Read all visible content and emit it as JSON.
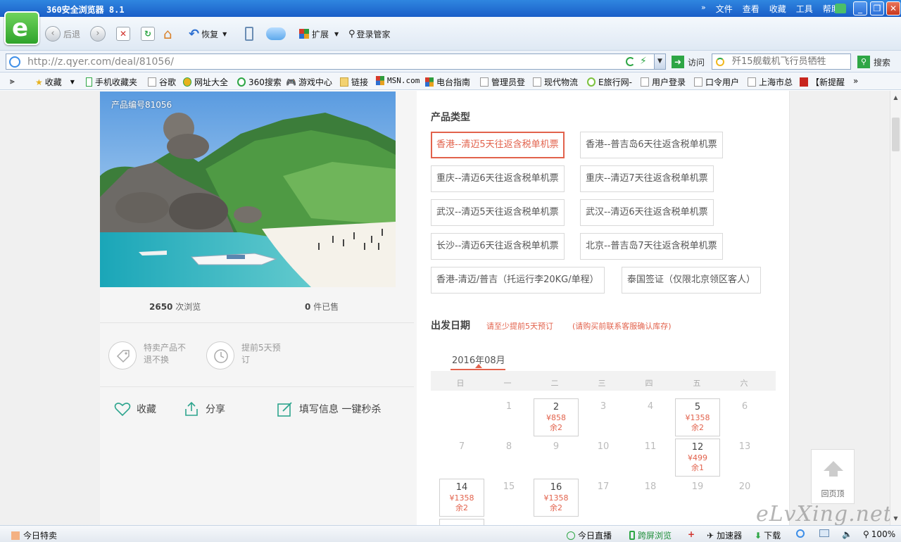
{
  "browser": {
    "title": "360安全浏览器 8.1",
    "menus": [
      "文件",
      "查看",
      "收藏",
      "工具",
      "帮助"
    ],
    "toolbar": {
      "back_label": "后退",
      "restore_label": "恢复",
      "extend_label": "扩展",
      "login_label": "登录管家"
    },
    "address": {
      "url": "http://z.qyer.com/deal/81056/",
      "go_label": "访问"
    },
    "search": {
      "placeholder": "歼15舰载机飞行员牺牲",
      "button_label": "搜索"
    },
    "favorites": [
      "收藏",
      "手机收藏夹",
      "谷歌",
      "网址大全",
      "360搜索",
      "游戏中心",
      "链接",
      "MSN.com",
      "电台指南",
      "管理员登",
      "现代物流",
      "E旅行网-",
      "用户登录",
      "口令用户",
      "上海市总",
      "【新提醒"
    ],
    "status": {
      "left_label": "今日特卖",
      "live_label": "今日直播",
      "cross_label": "跨屏浏览",
      "accel_label": "加速器",
      "download_label": "下载",
      "zoom": "100%"
    }
  },
  "deal": {
    "product_id": "产品编号81056",
    "views": "2650",
    "views_suffix": "次浏览",
    "sold": "0",
    "sold_suffix": "件已售",
    "feature1": [
      "特卖产品不",
      "退不换"
    ],
    "feature2": [
      "提前5天预",
      "订"
    ],
    "actions": {
      "favorite": "收藏",
      "share": "分享",
      "fill": "填写信息 一键秒杀"
    },
    "type_title": "产品类型",
    "types": [
      "香港--清迈5天往返含税单机票",
      "香港--普吉岛6天往返含税单机票",
      "重庆--清迈6天往返含税单机票",
      "重庆--清迈7天往返含税单机票",
      "武汉--清迈5天往返含税单机票",
      "武汉--清迈6天往返含税单机票",
      "长沙--清迈6天往返含税单机票",
      "北京--普吉岛7天往返含税单机票",
      "香港-清迈/普吉（托运行李20KG/单程）",
      "泰国签证（仅限北京领区客人）"
    ],
    "date_title": "出发日期",
    "note1": "请至少提前5天预订",
    "note2": "(请购买前联系客服确认库存)",
    "month": "2016年08月",
    "weekdays": [
      "日",
      "一",
      "二",
      "三",
      "四",
      "五",
      "六"
    ],
    "days": {
      "d1": "1",
      "d2": "2",
      "d3": "3",
      "d4": "4",
      "d5": "5",
      "d6": "6",
      "d7": "7",
      "d8": "8",
      "d9": "9",
      "d10": "10",
      "d11": "11",
      "d12": "12",
      "d13": "13",
      "d14": "14",
      "d15": "15",
      "d16": "16",
      "d17": "17",
      "d18": "18",
      "d19": "19",
      "d20": "20"
    },
    "prices": {
      "d2": "¥858",
      "d5": "¥1358",
      "d12": "¥499",
      "d14": "¥1358",
      "d16": "¥1358"
    },
    "stock": {
      "d2": "余2",
      "d5": "余2",
      "d12": "余1",
      "d14": "余2",
      "d16": "余2"
    },
    "back_top": "回页顶"
  },
  "watermark": "eLvXing.net"
}
